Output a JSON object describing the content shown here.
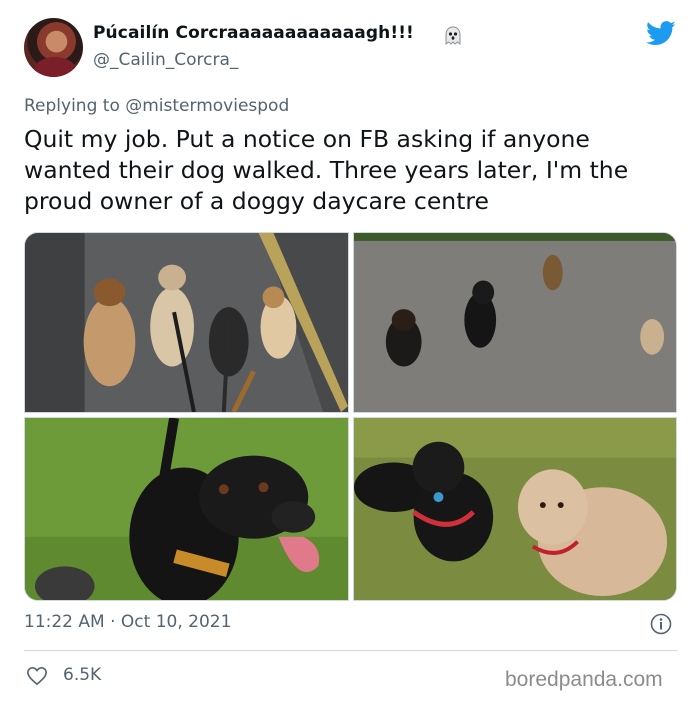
{
  "author": {
    "display_name": "Púcailín Corcraaaaaaaaaaaagh!!!",
    "handle": "@_Cailin_Corcra_",
    "avatar_icon": "profile-avatar",
    "badge_icon": "ghost-icon"
  },
  "platform_icon": "twitter-bird-icon",
  "reply": {
    "prefix": "Replying to",
    "mention": "@mistermoviespod"
  },
  "tweet_text": "Quit my job. Put a notice on FB asking if anyone wanted their dog walked. Three years later, I'm the proud owner of a doggy daycare centre",
  "media": [
    {
      "icon": "photo-dogs-walking-on-leash"
    },
    {
      "icon": "photo-dogs-on-gravel"
    },
    {
      "icon": "photo-black-dog-tongue-out"
    },
    {
      "icon": "photo-black-dog-and-curly-dog"
    }
  ],
  "timestamp": "11:22 AM · Oct 10, 2021",
  "likes": "6.5K",
  "watermark": "boredpanda.com",
  "colors": {
    "twitter_blue": "#1d9bf0",
    "secondary_text": "#536471",
    "divider": "#cfd9de"
  }
}
